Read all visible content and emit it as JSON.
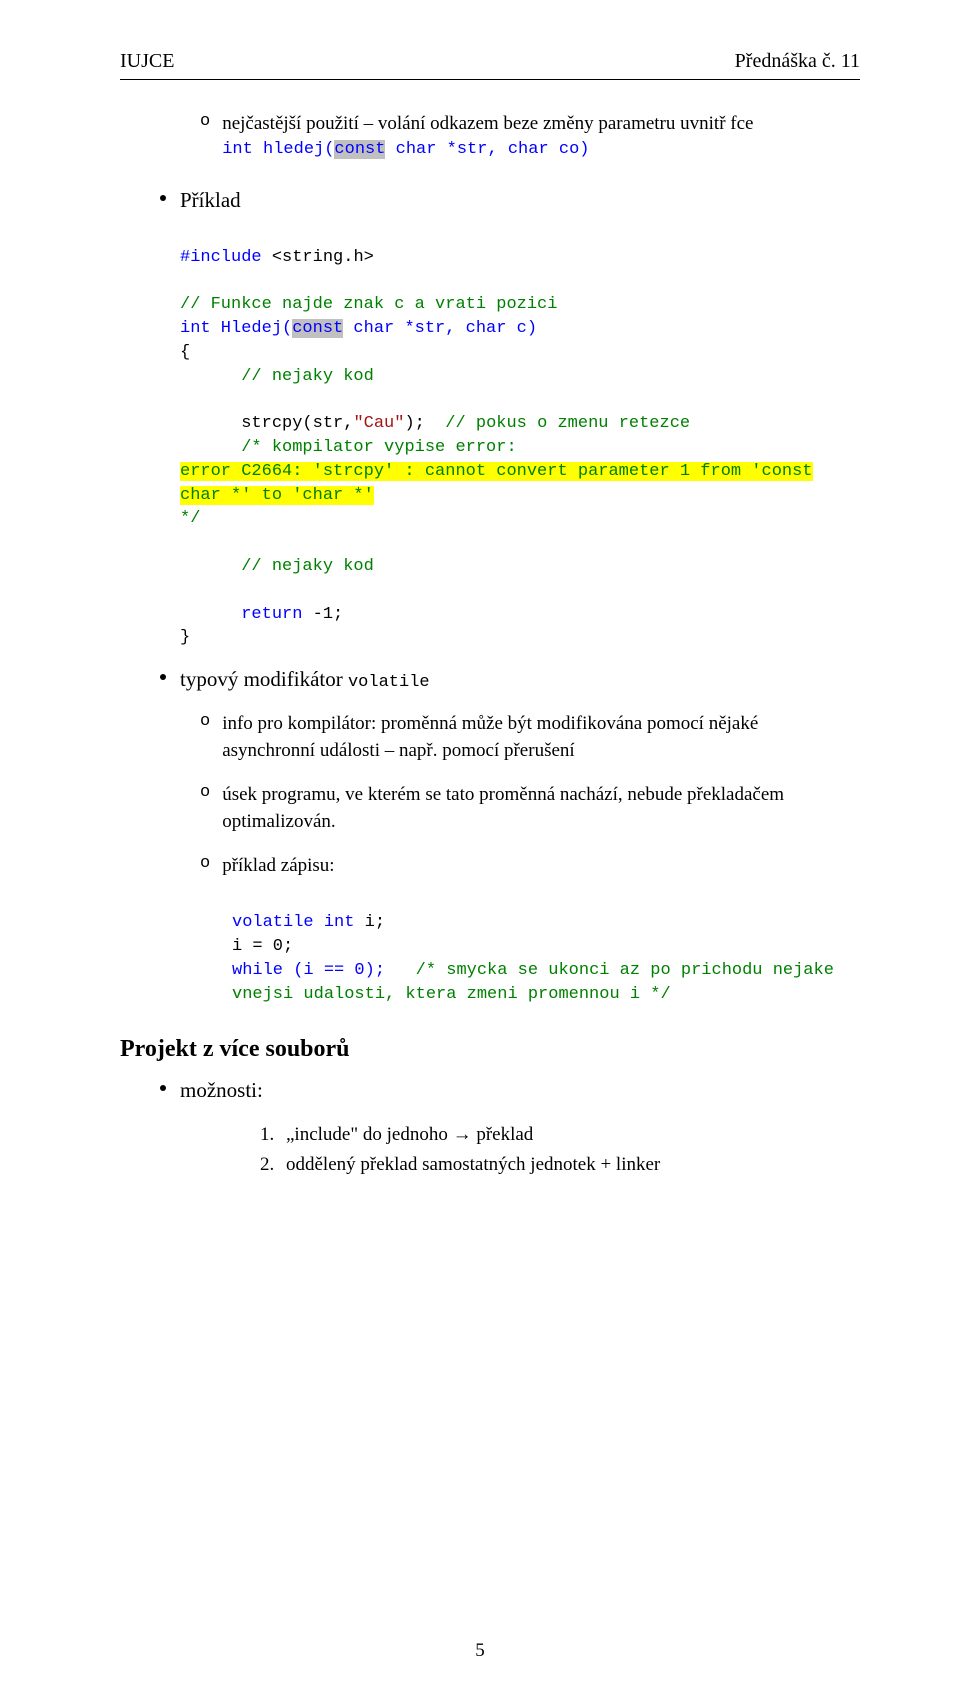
{
  "header": {
    "left": "IUJCE",
    "right": "Přednáška č. 11"
  },
  "s1": {
    "o": "o",
    "intro": "nejčastější použití – volání odkazem beze změny parametru uvnitř fce",
    "code_pre": "int hledej(",
    "code_const": "const",
    "code_post": " char *str, char co)"
  },
  "s2": {
    "title": "Příklad",
    "inc1": "#include ",
    "inc2": "<string.h>",
    "com1": "// Funkce najde znak c a vrati pozici",
    "sig1": "int Hledej(",
    "sig_const": "const",
    "sig2": " char *str, char c)",
    "ob": "{",
    "com2": "// nejaky kod",
    "l1a": "strcpy(str,",
    "l1b": "\"Cau\"",
    "l1c": ");  ",
    "l1d": "// pokus o zmenu retezce",
    "l2": "/* kompilator vypise error:",
    "l3": "error C2664: 'strcpy' : cannot convert parameter 1 from 'const",
    "l4": "char *' to 'char *'",
    "l5": "*/",
    "com3": "// nejaky kod",
    "ret1": "return ",
    "ret2": "-1",
    "cb": "}"
  },
  "s3": {
    "title_a": "typový modifikátor ",
    "title_b": "volatile",
    "b1": {
      "o": "o",
      "t": "info pro kompilátor: proměnná může být modifikována pomocí nějaké asynchronní události – např. pomocí přerušení"
    },
    "b2": {
      "o": "o",
      "t": "úsek programu, ve kterém se tato proměnná nachází, nebude překladačem optimalizován."
    },
    "b3": {
      "o": "o",
      "t": "příklad zápisu:"
    },
    "c1a": "volatile int ",
    "c1b": "i;",
    "c2": "i = 0;",
    "c3a": "while (i == 0);   ",
    "c3b": "/* smycka se ukonci az po prichodu nejake",
    "c4": "vnejsi udalosti, ktera zmeni promennou i */"
  },
  "s4": {
    "h": "Projekt z více souborů",
    "m": "možnosti:",
    "n1": "1.",
    "i1": "„include\" do jednoho → překlad",
    "n2": "2.",
    "i2": "oddělený překlad samostatných jednotek + linker"
  },
  "footer": "5"
}
